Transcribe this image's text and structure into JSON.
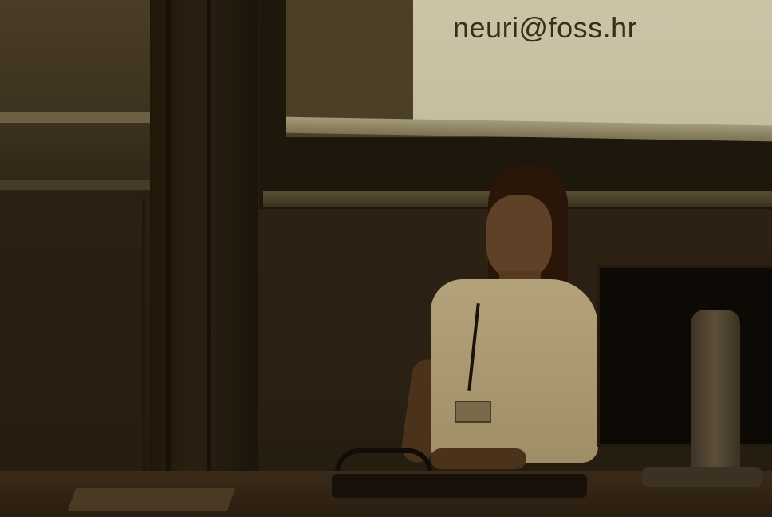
{
  "slide": {
    "email": "neuri@foss.hr"
  }
}
